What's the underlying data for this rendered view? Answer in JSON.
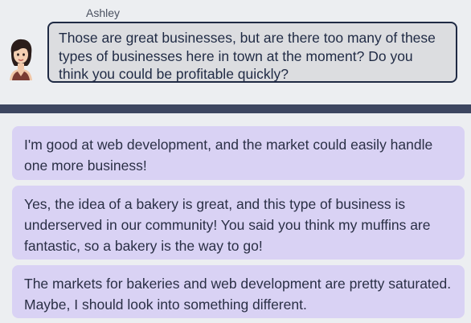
{
  "dialog": {
    "speaker_name": "Ashley",
    "message": "Those are great businesses, but are there too many of these types of businesses here in town at the moment? Do you think you could be profitable quickly?"
  },
  "options": [
    {
      "text": "I'm good at web development, and the market could easily handle one more business!"
    },
    {
      "text": "Yes, the idea of a bakery is great, and this type of business is underserved in our community! You said you think my muffins are fantastic, so a bakery is the way to go!"
    },
    {
      "text": "The markets for bakeries and web development are pretty saturated. Maybe, I should look into something different."
    }
  ],
  "colors": {
    "background": "#eceef1",
    "bubble_fill": "#dcdde0",
    "bubble_border": "#1f2a44",
    "divider": "#3d4660",
    "option_fill": "#d9d2f4"
  },
  "icons": {
    "avatar": "woman-avatar-icon"
  }
}
